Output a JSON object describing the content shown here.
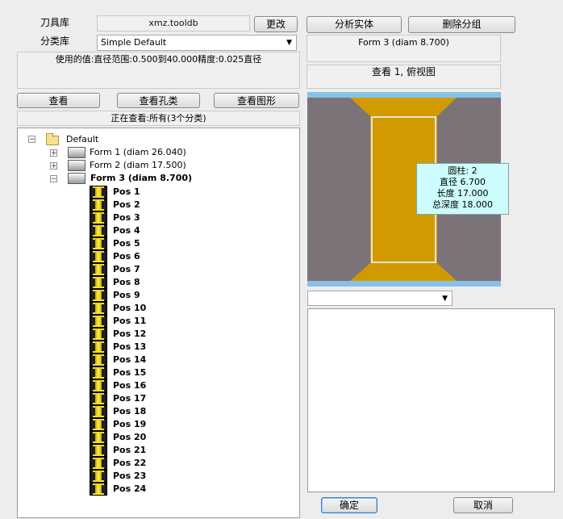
{
  "library": {
    "label": "刀具库",
    "value": "xmz.tooldb",
    "change_button": "更改"
  },
  "category": {
    "label": "分类库",
    "selected": "Simple Default"
  },
  "used_values": "使用的值:直径范围:0.500到40.000精度:0.025直径",
  "buttons": {
    "view": "查看",
    "view_holes": "查看孔类",
    "view_shapes": "查看图形"
  },
  "viewing_status": "正在查看:所有(3个分类)",
  "tree": {
    "root": "Default",
    "forms": [
      {
        "label": "Form  1 (diam 26.040)",
        "expanded": false
      },
      {
        "label": "Form  2 (diam 17.500)",
        "expanded": false
      },
      {
        "label": "Form  3 (diam 8.700)",
        "expanded": true
      }
    ],
    "positions": [
      "Pos 1",
      "Pos 2",
      "Pos 3",
      "Pos 4",
      "Pos 5",
      "Pos 6",
      "Pos 7",
      "Pos 8",
      "Pos 9",
      "Pos 10",
      "Pos 11",
      "Pos 12",
      "Pos 13",
      "Pos 14",
      "Pos 15",
      "Pos 16",
      "Pos 17",
      "Pos 18",
      "Pos 19",
      "Pos 20",
      "Pos 21",
      "Pos 22",
      "Pos 23",
      "Pos 24"
    ]
  },
  "right": {
    "analyze_button": "分析实体",
    "delete_group_button": "删除分组",
    "form_info": "Form  3 (diam 8.700)",
    "view_caption": "查看 1,  俯视图",
    "tooltip": [
      "圆柱: 2",
      "直径 6.700",
      "长度 17.000",
      "总深度 18.000"
    ],
    "dropdown_selected": ""
  },
  "footer": {
    "ok": "确定",
    "cancel": "取消"
  },
  "colors": {
    "preview_bg": "#7b7378",
    "tool_body": "#d19a00",
    "edge_blue": "#87c1e8",
    "tooltip_bg": "#ccfcfd"
  }
}
